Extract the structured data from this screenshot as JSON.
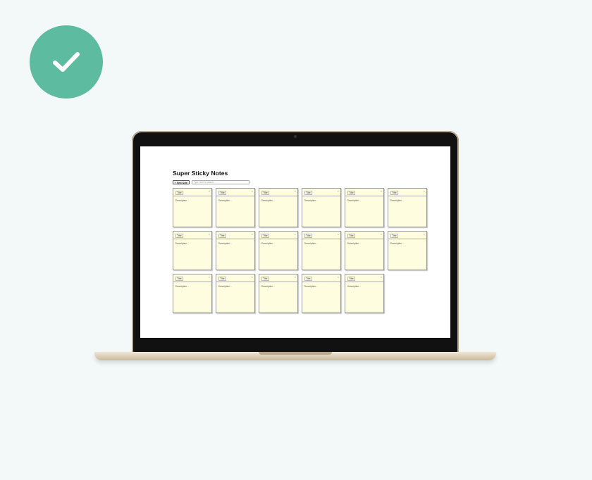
{
  "badge": {
    "icon": "checkmark-icon",
    "color": "#5dbba0"
  },
  "app": {
    "title": "Super Sticky Notes",
    "new_note_label": "+ New Note",
    "search_placeholder": "Type here to search...",
    "notes": [
      {
        "title": "Title",
        "body": "Description...",
        "close": "×"
      },
      {
        "title": "Title",
        "body": "Description...",
        "close": "×"
      },
      {
        "title": "Title",
        "body": "Description...",
        "close": "×"
      },
      {
        "title": "Title",
        "body": "Description...",
        "close": "×"
      },
      {
        "title": "Title",
        "body": "Description...",
        "close": "×"
      },
      {
        "title": "Title",
        "body": "Description...",
        "close": "×"
      },
      {
        "title": "Title",
        "body": "Description...",
        "close": "×"
      },
      {
        "title": "Title",
        "body": "Description...",
        "close": "×"
      },
      {
        "title": "Title",
        "body": "Description...",
        "close": "×"
      },
      {
        "title": "Title",
        "body": "Description...",
        "close": "×"
      },
      {
        "title": "Title",
        "body": "Description...",
        "close": "×"
      },
      {
        "title": "Title",
        "body": "Description...",
        "close": "×"
      },
      {
        "title": "Title",
        "body": "Description...",
        "close": "×"
      },
      {
        "title": "Title",
        "body": "Description...",
        "close": "×"
      },
      {
        "title": "Title",
        "body": "Description...",
        "close": "×"
      },
      {
        "title": "Title",
        "body": "Description...",
        "close": "×"
      },
      {
        "title": "Title",
        "body": "Description...",
        "close": "×"
      }
    ]
  }
}
